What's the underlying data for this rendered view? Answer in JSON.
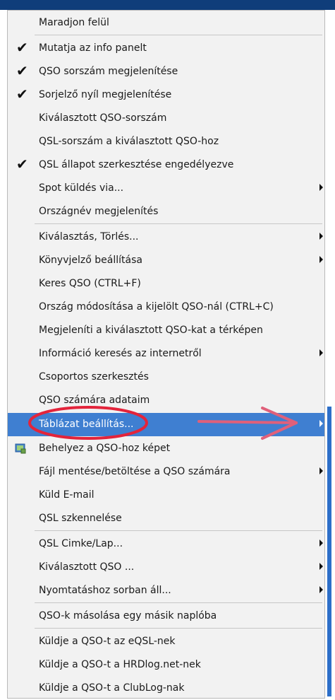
{
  "menu": {
    "items": [
      {
        "label": "Maradjon felül"
      },
      {
        "label": "Mutatja az info panelt",
        "checked": true
      },
      {
        "label": "QSO sorszám megjelenítése",
        "checked": true
      },
      {
        "label": "Sorjelző nyíl megjelenítése",
        "checked": true
      },
      {
        "label": "Kiválasztott QSO-sorszám"
      },
      {
        "label": "QSL-sorszám a kiválasztott QSO-hoz"
      },
      {
        "label": "QSL állapot szerkesztése engedélyezve",
        "checked": true
      },
      {
        "label": "Spot küldés via...",
        "submenu": true
      },
      {
        "label": "Országnév megjelenítés"
      },
      {
        "label": "Kiválasztás, Törlés...",
        "submenu": true
      },
      {
        "label": "Könyvjelző beállítása",
        "submenu": true
      },
      {
        "label": "Keres QSO (CTRL+F)"
      },
      {
        "label": "Ország módosítása a kijelölt QSO-nál (CTRL+C)"
      },
      {
        "label": "Megjeleníti a kiválasztott QSO-kat a térképen"
      },
      {
        "label": "Információ keresés az internetről",
        "submenu": true
      },
      {
        "label": "Csoportos szerkesztés"
      },
      {
        "label": "QSO számára adataim"
      },
      {
        "label": "Táblázat beállítás...",
        "submenu": true,
        "highlighted": true
      },
      {
        "label": "Behelyez a QSO-hoz képet",
        "icon": "image-icon"
      },
      {
        "label": "Fájl mentése/betöltése a QSO számára",
        "submenu": true
      },
      {
        "label": "Küld E-mail"
      },
      {
        "label": "QSL szkennelése"
      },
      {
        "label": "QSL Cimke/Lap...",
        "submenu": true
      },
      {
        "label": "Kiválasztott QSO ...",
        "submenu": true
      },
      {
        "label": "Nyomtatáshoz sorban áll...",
        "submenu": true
      },
      {
        "label": "QSO-k másolása egy másik naplóba"
      },
      {
        "label": "Küldje a QSO-t az eQSL-nek"
      },
      {
        "label": "Küldje a QSO-t a HRDlog.net-nek"
      },
      {
        "label": "Küldje a QSO-t a ClubLog-nak"
      }
    ]
  },
  "colors": {
    "highlight": "#3f7fd1",
    "annotation": "#e3243b",
    "arrow": "#e0607a"
  }
}
